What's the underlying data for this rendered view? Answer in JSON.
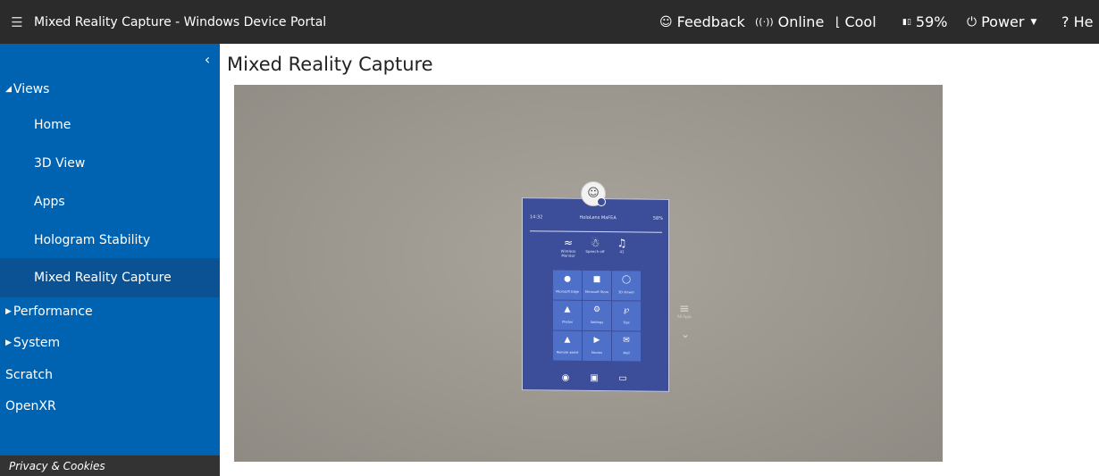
{
  "topbar": {
    "menu_icon": "hamburger-icon",
    "title": "Mixed Reality Capture - Windows Device Portal",
    "feedback": {
      "icon": "smiley-icon",
      "label": "Feedback"
    },
    "online": {
      "icon": "wireless-signal-icon",
      "label": "Online"
    },
    "thermal": {
      "icon": "thermometer-icon",
      "label": "Cool"
    },
    "battery": {
      "icon": "battery-icon",
      "label": "59%"
    },
    "power": {
      "icon": "power-icon",
      "label": "Power"
    },
    "help": {
      "label": "? He"
    }
  },
  "sidebar": {
    "collapse_icon": "chevron-left-icon",
    "views_label": "Views",
    "items": [
      {
        "label": "Home"
      },
      {
        "label": "3D View"
      },
      {
        "label": "Apps"
      },
      {
        "label": "Hologram Stability"
      },
      {
        "label": "Mixed Reality Capture",
        "selected": true
      }
    ],
    "performance_label": "Performance",
    "system_label": "System",
    "scratch_label": "Scratch",
    "openxr_label": "OpenXR",
    "privacy_label": "Privacy & Cookies"
  },
  "main": {
    "page_title": "Mixed Reality Capture",
    "preview": {
      "panel_time": "14:32",
      "panel_device": "HoloLens MaFEA",
      "panel_battery": "58%",
      "quick_actions": [
        {
          "icon": "wireless-icon",
          "label": "Wireless Monitor"
        },
        {
          "icon": "microphone-icon",
          "label": "Speech off"
        },
        {
          "icon": "volume-icon",
          "label": "41"
        }
      ],
      "tiles": [
        {
          "icon": "edge-icon",
          "label": "Microsoft Edge"
        },
        {
          "icon": "store-icon",
          "label": "Microsoft Store"
        },
        {
          "icon": "cube-icon",
          "label": "3D Viewer"
        },
        {
          "icon": "photos-icon",
          "label": "Photos"
        },
        {
          "icon": "settings-icon",
          "label": "Settings"
        },
        {
          "icon": "tips-icon",
          "label": "Tips"
        },
        {
          "icon": "remote-assist-icon",
          "label": "Remote assist"
        },
        {
          "icon": "movies-icon",
          "label": "Movies"
        },
        {
          "icon": "mail-icon",
          "label": "Mail"
        }
      ],
      "bottom_icons": [
        "camera-icon",
        "video-icon",
        "cast-icon"
      ],
      "side_label": "All Apps"
    }
  },
  "colors": {
    "topbar_bg": "#2b2b2b",
    "sidebar_bg": "#0063b1",
    "sidebar_selected_bg": "#0a5294",
    "privacy_bg": "#333333",
    "holo_panel_bg": "#3c4d9a",
    "tile_bg": "#4f70c9"
  }
}
